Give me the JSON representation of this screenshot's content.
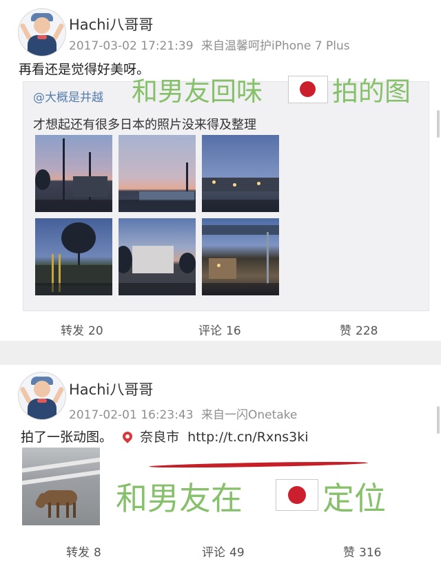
{
  "posts": [
    {
      "username": "Hachi八哥哥",
      "timestamp": "2017-03-02 17:21:39",
      "source": "来自温馨呵护iPhone 7 Plus",
      "text": "再看还是觉得好美呀。",
      "repost": {
        "mention": "@大概是井越",
        "text": "才想起还有很多日本的照片没来得及整理",
        "image_count": 6
      },
      "annotation": {
        "before_flag": "和男友回味",
        "after_flag": "拍的图"
      },
      "actions": {
        "repost_label": "转发",
        "repost_count": "20",
        "comment_label": "评论",
        "comment_count": "16",
        "like_label": "赞",
        "like_count": "228"
      }
    },
    {
      "username": "Hachi八哥哥",
      "timestamp": "2017-02-01 16:23:43",
      "source": "来自一闪Onetake",
      "text": "拍了一张动图。",
      "location": "奈良市",
      "link": "http://t.cn/Rxns3ki",
      "annotation": {
        "before_flag": "和男友在",
        "after_flag": "定位"
      },
      "actions": {
        "repost_label": "转发",
        "repost_count": "8",
        "comment_label": "评论",
        "comment_count": "49",
        "like_label": "赞",
        "like_count": "316"
      }
    }
  ],
  "colors": {
    "annotation_green": "#86c06a",
    "mention_blue": "#567dae",
    "flag_red": "#cc1f2d",
    "underline_red": "#c71f27"
  },
  "icons": [
    "avatar",
    "japan-flag-icon",
    "location-pin-icon"
  ]
}
